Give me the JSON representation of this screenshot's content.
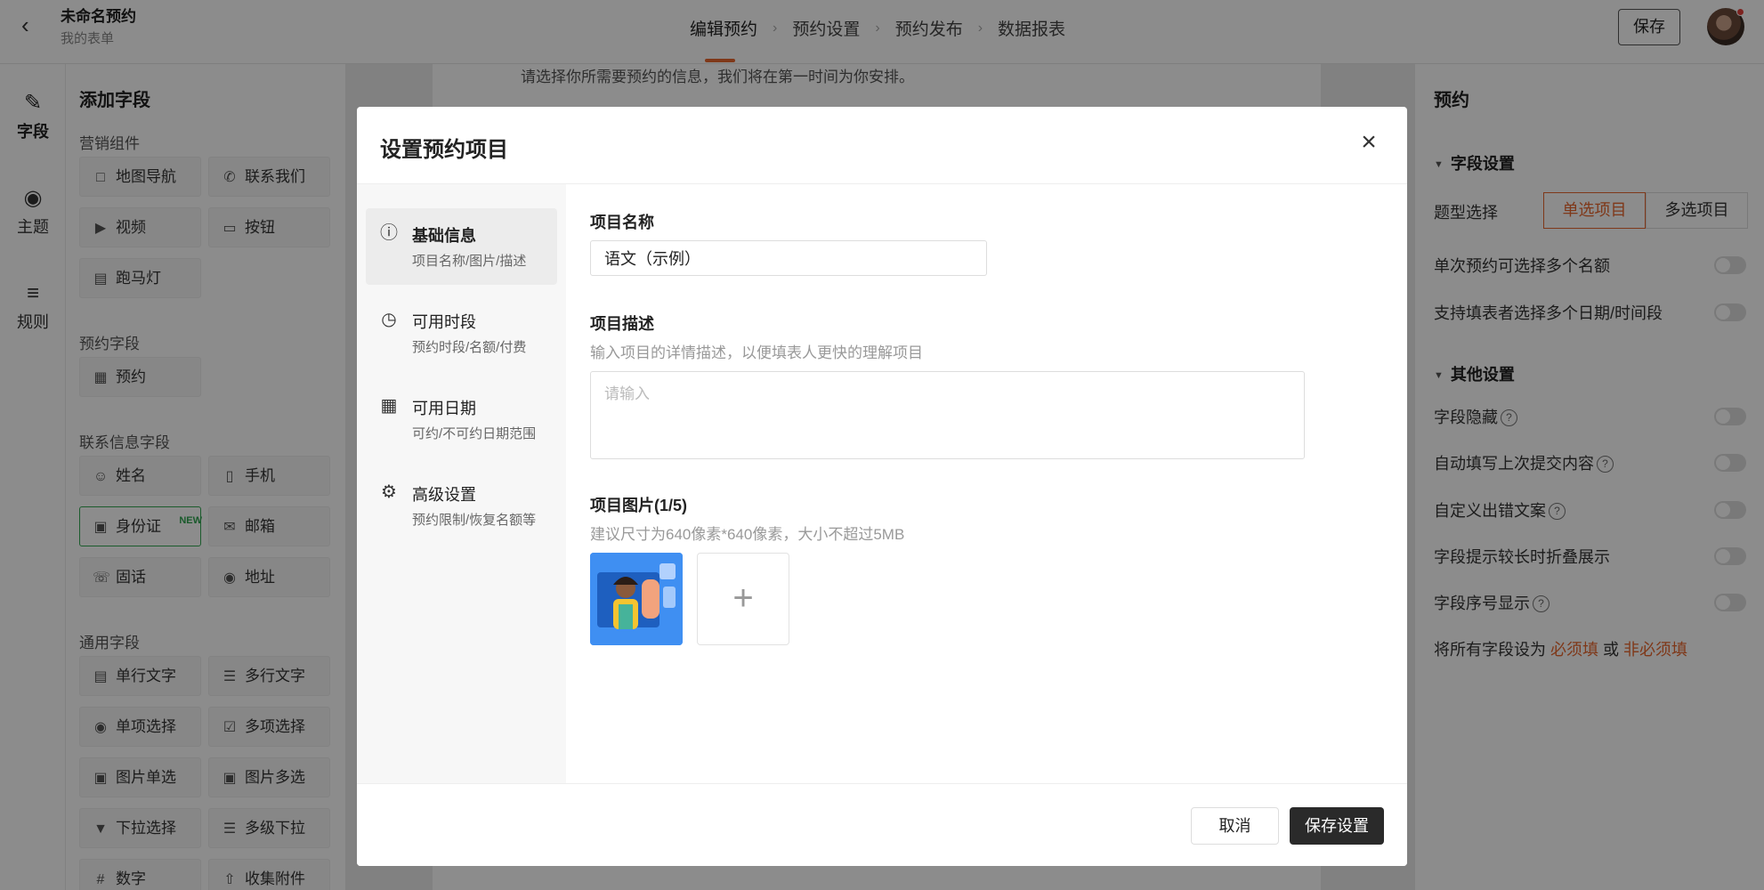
{
  "topbar": {
    "title": "未命名预约",
    "subtitle": "我的表单",
    "steps": [
      "编辑预约",
      "预约设置",
      "预约发布",
      "数据报表"
    ],
    "save_label": "保存"
  },
  "rail": {
    "items": [
      {
        "label": "字段",
        "icon": "field-icon"
      },
      {
        "label": "主题",
        "icon": "palette-icon"
      },
      {
        "label": "规则",
        "icon": "rules-icon"
      }
    ]
  },
  "fields": {
    "title": "添加字段",
    "sections": {
      "marketing": "营销组件",
      "booking": "预约字段",
      "contact": "联系信息字段",
      "general": "通用字段"
    },
    "marketing_items": [
      "地图导航",
      "联系我们",
      "视频",
      "按钮",
      "跑马灯"
    ],
    "booking_items": [
      "预约"
    ],
    "contact_items": [
      "姓名",
      "手机",
      "身份证",
      "邮箱",
      "固话",
      "地址"
    ],
    "new_badge": "NEW",
    "general_items": [
      "单行文字",
      "多行文字",
      "单项选择",
      "多项选择",
      "图片单选",
      "图片多选",
      "下拉选择",
      "多级下拉",
      "数字",
      "收集附件"
    ]
  },
  "canvas": {
    "intro_line": "请选择你所需要预约的信息，我们将在第一时间为你安排。"
  },
  "rpanel": {
    "title": "预约",
    "field_settings": "字段设置",
    "type_label": "题型选择",
    "type_options": [
      "单选项目",
      "多选项目"
    ],
    "multi_quota": "单次预约可选择多个名额",
    "multi_datetime": "支持填表者选择多个日期/时间段",
    "other_settings": "其他设置",
    "hide_field": "字段隐藏",
    "autofill": "自动填写上次提交内容",
    "custom_error": "自定义出错文案",
    "fold_hint": "字段提示较长时折叠展示",
    "show_index": "字段序号显示",
    "set_all_prefix": "将所有字段设为",
    "required": "必须填",
    "or": "或",
    "optional": "非必须填"
  },
  "modal": {
    "title": "设置预约项目",
    "nav": [
      {
        "title": "基础信息",
        "sub": "项目名称/图片/描述",
        "icon": "info-icon"
      },
      {
        "title": "可用时段",
        "sub": "预约时段/名额/付费",
        "icon": "clock-icon"
      },
      {
        "title": "可用日期",
        "sub": "可约/不可约日期范围",
        "icon": "calendar-icon"
      },
      {
        "title": "高级设置",
        "sub": "预约限制/恢复名额等",
        "icon": "sliders-icon"
      }
    ],
    "name_label": "项目名称",
    "name_value": "语文（示例）",
    "desc_label": "项目描述",
    "desc_hint": "输入项目的详情描述，以便填表人更快的理解项目",
    "desc_placeholder": "请输入",
    "image_label": "项目图片(1/5)",
    "image_hint": "建议尺寸为640像素*640像素，大小不超过5MB",
    "cancel_label": "取消",
    "save_label": "保存设置"
  }
}
